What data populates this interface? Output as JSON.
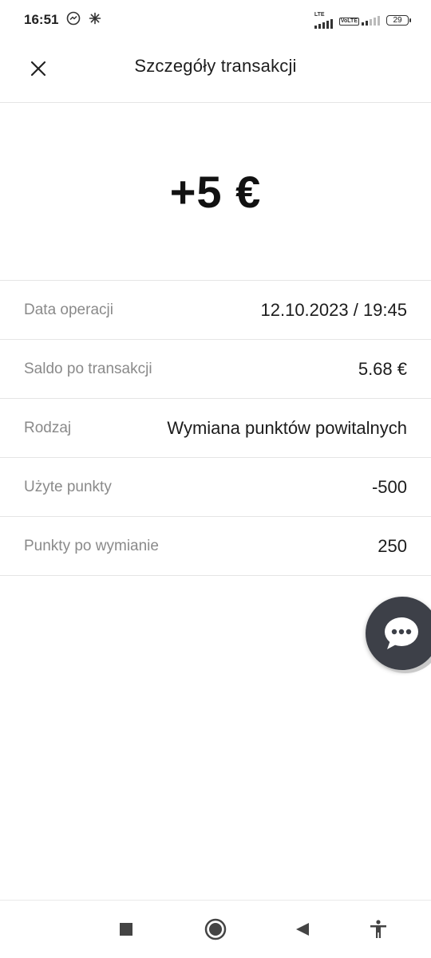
{
  "status_bar": {
    "time": "16:51",
    "network_1": "LTE",
    "network_2": "VoLTE",
    "battery": "29"
  },
  "header": {
    "title": "Szczegóły transakcji",
    "close_icon": "close-icon"
  },
  "transaction": {
    "amount": "+5 €"
  },
  "details": [
    {
      "label": "Data operacji",
      "value": "12.10.2023 / 19:45"
    },
    {
      "label": "Saldo po transakcji",
      "value": "5.68 €"
    },
    {
      "label": "Rodzaj",
      "value": "Wymiana punktów powitalnych"
    },
    {
      "label": "Użyte punkty",
      "value": "-500"
    },
    {
      "label": "Punkty po wymianie",
      "value": "250"
    }
  ],
  "chat": {
    "icon": "chat-bubble-icon"
  },
  "nav_bar": {
    "icons": [
      "recents-icon",
      "home-icon",
      "back-icon",
      "accessibility-icon"
    ]
  },
  "colors": {
    "fab": "#3d4048",
    "label": "#8a8a8a",
    "divider": "#e5e5e5"
  }
}
